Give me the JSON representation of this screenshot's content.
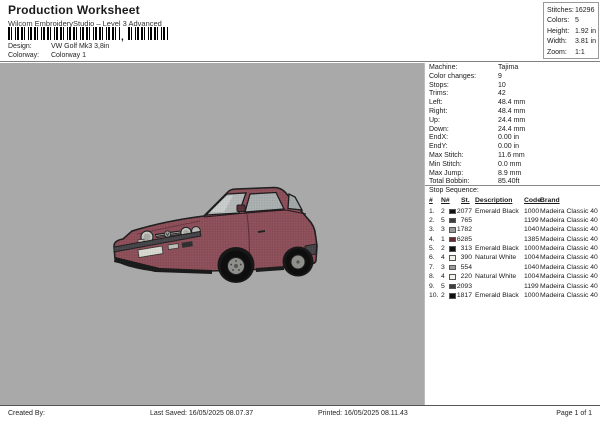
{
  "header": {
    "title": "Production Worksheet",
    "subtitle": "Wilcom EmbroideryStudio – Level 3 Advanced",
    "design_label": "Design:",
    "design_value": "VW Golf Mk3 3,8in",
    "colorway_label": "Colorway:",
    "colorway_value": "Colorway 1",
    "barcode_comma": ","
  },
  "stats": {
    "rows": [
      {
        "label": "Stitches:",
        "value": "16296"
      },
      {
        "label": "Colors:",
        "value": "5"
      },
      {
        "label": "Height:",
        "value": "1.92 in"
      },
      {
        "label": "Width:",
        "value": "3.81 in"
      },
      {
        "label": "Zoom:",
        "value": "1:1"
      }
    ]
  },
  "machine_info": {
    "rows": [
      {
        "label": "Machine:",
        "value": "Tajima"
      },
      {
        "label": "Color changes:",
        "value": "9"
      },
      {
        "label": "Stops:",
        "value": "10"
      },
      {
        "label": "Trims:",
        "value": "42"
      },
      {
        "label": "Left:",
        "value": "48.4 mm"
      },
      {
        "label": "Right:",
        "value": "48.4 mm"
      },
      {
        "label": "Up:",
        "value": "24.4 mm"
      },
      {
        "label": "Down:",
        "value": "24.4 mm"
      },
      {
        "label": "EndX:",
        "value": "0.00 in"
      },
      {
        "label": "EndY:",
        "value": "0.00 in"
      },
      {
        "label": "Max Stitch:",
        "value": "11.6 mm"
      },
      {
        "label": "Min Stitch:",
        "value": "0.0 mm"
      },
      {
        "label": "Max Jump:",
        "value": "8.9 mm"
      },
      {
        "label": "Total Bobbin:",
        "value": "85.40ft"
      }
    ]
  },
  "stop_sequence": {
    "title": "Stop Sequence:",
    "columns": {
      "num": "#",
      "n": "N#",
      "st": "St.",
      "description": "Description",
      "code": "Code",
      "brand": "Brand"
    },
    "rows": [
      {
        "num": "1.",
        "n": "2",
        "swatch": "#101010",
        "st": "2077",
        "description": "Emerald Black",
        "code": "1000",
        "brand": "Madeira Classic 40"
      },
      {
        "num": "2.",
        "n": "5",
        "swatch": "#3c3c41",
        "st": "765",
        "description": "",
        "code": "1199",
        "brand": "Madeira Classic 40"
      },
      {
        "num": "3.",
        "n": "3",
        "swatch": "#999999",
        "st": "1782",
        "description": "",
        "code": "1040",
        "brand": "Madeira Classic 40"
      },
      {
        "num": "4.",
        "n": "1",
        "swatch": "#66272f",
        "st": "6285",
        "description": "",
        "code": "1385",
        "brand": "Madeira Classic 40"
      },
      {
        "num": "5.",
        "n": "2",
        "swatch": "#101010",
        "st": "313",
        "description": "Emerald Black",
        "code": "1000",
        "brand": "Madeira Classic 40"
      },
      {
        "num": "6.",
        "n": "4",
        "swatch": "#f1f1ec",
        "st": "390",
        "description": "Natural White",
        "code": "1004",
        "brand": "Madeira Classic 40"
      },
      {
        "num": "7.",
        "n": "3",
        "swatch": "#999999",
        "st": "554",
        "description": "",
        "code": "1040",
        "brand": "Madeira Classic 40"
      },
      {
        "num": "8.",
        "n": "4",
        "swatch": "#f1f1ec",
        "st": "220",
        "description": "Natural White",
        "code": "1004",
        "brand": "Madeira Classic 40"
      },
      {
        "num": "9.",
        "n": "5",
        "swatch": "#3c3c41",
        "st": "2093",
        "description": "",
        "code": "1199",
        "brand": "Madeira Classic 40"
      },
      {
        "num": "10.",
        "n": "2",
        "swatch": "#101010",
        "st": "1817",
        "description": "Emerald Black",
        "code": "1000",
        "brand": "Madeira Classic 40"
      }
    ]
  },
  "footer": {
    "created_by": "Created By:",
    "last_saved": "Last Saved: 16/05/2025 08.07.37",
    "printed": "Printed: 16/05/2025 08.11.43",
    "page": "Page 1 of 1"
  }
}
